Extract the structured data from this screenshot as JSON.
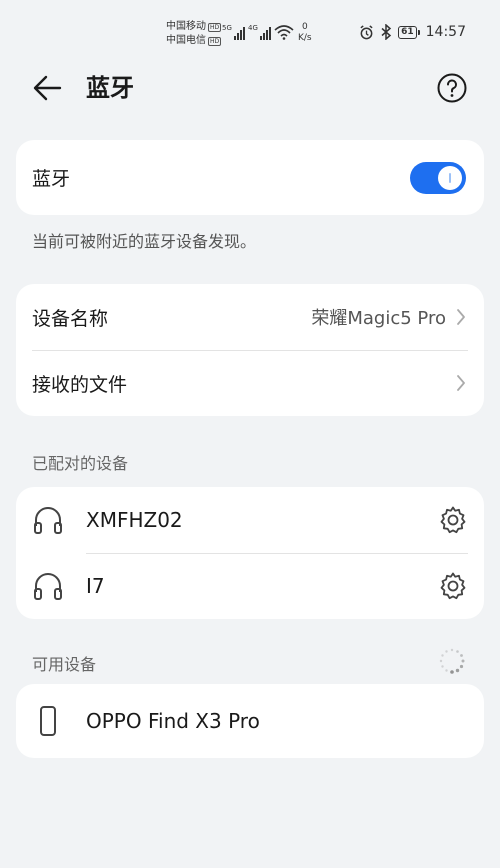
{
  "status_bar": {
    "carrier1": "中国移动",
    "carrier2": "中国电信",
    "hd": "HD",
    "net1": "5G",
    "net2": "4G",
    "speed_value": "0",
    "speed_unit": "K/s",
    "battery": "61",
    "time": "14:57"
  },
  "header": {
    "title": "蓝牙",
    "back_icon": "arrow-left-icon",
    "help_icon": "question-circle-icon"
  },
  "bluetooth": {
    "label": "蓝牙",
    "enabled": true,
    "accent": "#1e6ff0"
  },
  "discoverable_note": "当前可被附近的蓝牙设备发现。",
  "device_settings": {
    "name_label": "设备名称",
    "name_value": "荣耀Magic5 Pro",
    "received_label": "接收的文件"
  },
  "paired": {
    "title": "已配对的设备",
    "devices": [
      {
        "name": "XMFHZ02",
        "icon": "headphones-icon"
      },
      {
        "name": "I7",
        "icon": "headphones-icon"
      }
    ]
  },
  "available": {
    "title": "可用设备",
    "devices": [
      {
        "name": "OPPO Find X3 Pro",
        "icon": "phone-icon"
      }
    ]
  }
}
